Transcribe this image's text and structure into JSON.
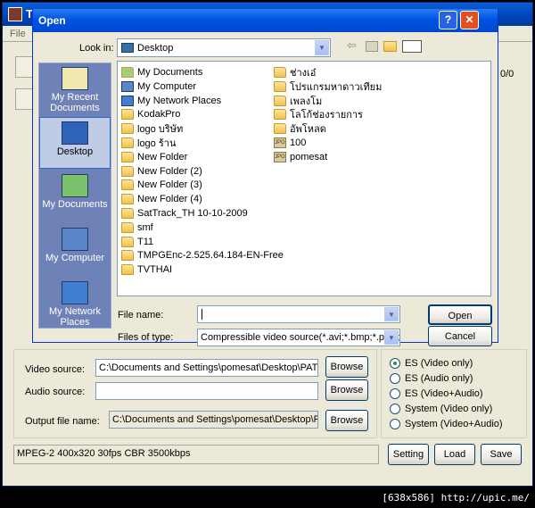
{
  "background_app": {
    "title": "T",
    "menu_file": "File",
    "counter": "0/0",
    "video_source_label": "Video source:",
    "video_source_value": "C:\\Documents and Settings\\pomesat\\Desktop\\PATTA",
    "audio_source_label": "Audio source:",
    "audio_source_value": "",
    "output_file_label": "Output file name:",
    "output_file_value": "C:\\Documents and Settings\\pomesat\\Desktop\\PAT",
    "browse_label": "Browse",
    "status_text": "MPEG-2 400x320 30fps CBR 3500kbps",
    "setting_label": "Setting",
    "load_label": "Load",
    "save_label": "Save",
    "radio_options": [
      {
        "label": "ES (Video only)",
        "selected": true
      },
      {
        "label": "ES (Audio only)",
        "selected": false
      },
      {
        "label": "ES (Video+Audio)",
        "selected": false
      },
      {
        "label": "System (Video only)",
        "selected": false
      },
      {
        "label": "System (Video+Audio)",
        "selected": false
      }
    ]
  },
  "dialog": {
    "title": "Open",
    "help_glyph": "?",
    "close_glyph": "✕",
    "look_in_label": "Look in:",
    "look_in_value": "Desktop",
    "places": [
      {
        "label": "My Recent Documents",
        "icon": "recent-documents-icon",
        "selected": false
      },
      {
        "label": "Desktop",
        "icon": "desktop-icon",
        "selected": true
      },
      {
        "label": "My Documents",
        "icon": "my-documents-icon",
        "selected": false
      },
      {
        "label": "My Computer",
        "icon": "my-computer-icon",
        "selected": false
      },
      {
        "label": "My Network Places",
        "icon": "network-places-icon",
        "selected": false
      }
    ],
    "files_col1": [
      {
        "name": "My Documents",
        "type": "mydocs"
      },
      {
        "name": "My Computer",
        "type": "computer"
      },
      {
        "name": "My Network Places",
        "type": "network"
      },
      {
        "name": "KodakPro",
        "type": "folder"
      },
      {
        "name": "logo บริษัท",
        "type": "folder"
      },
      {
        "name": "logo ร้าน",
        "type": "folder"
      },
      {
        "name": "New Folder",
        "type": "folder"
      },
      {
        "name": "New Folder (2)",
        "type": "folder"
      },
      {
        "name": "New Folder (3)",
        "type": "folder"
      },
      {
        "name": "New Folder (4)",
        "type": "folder"
      },
      {
        "name": "SatTrack_TH 10-10-2009",
        "type": "folder"
      },
      {
        "name": "smf",
        "type": "folder"
      },
      {
        "name": "T11",
        "type": "folder"
      },
      {
        "name": "TMPGEnc-2.525.64.184-EN-Free",
        "type": "folder"
      },
      {
        "name": "TVTHAI",
        "type": "folder"
      }
    ],
    "files_col2": [
      {
        "name": "ช่างเอ๋",
        "type": "folder"
      },
      {
        "name": "โปรแกรมหาดาวเทียม",
        "type": "folder"
      },
      {
        "name": "เพลงโม",
        "type": "folder"
      },
      {
        "name": "โลโก้ช่องรายการ",
        "type": "folder"
      },
      {
        "name": "อัพโหลด",
        "type": "folder"
      },
      {
        "name": "100",
        "type": "jpg"
      },
      {
        "name": "pomesat",
        "type": "jpg"
      }
    ],
    "file_name_label": "File name:",
    "file_name_value": "",
    "files_of_type_label": "Files of type:",
    "files_of_type_value": "Compressible video source(*.avi;*.bmp;*.ppm;*.t",
    "open_label": "Open",
    "cancel_label": "Cancel",
    "jpg_badge": "JPG"
  },
  "watermark": "[638x586] http://upic.me/"
}
